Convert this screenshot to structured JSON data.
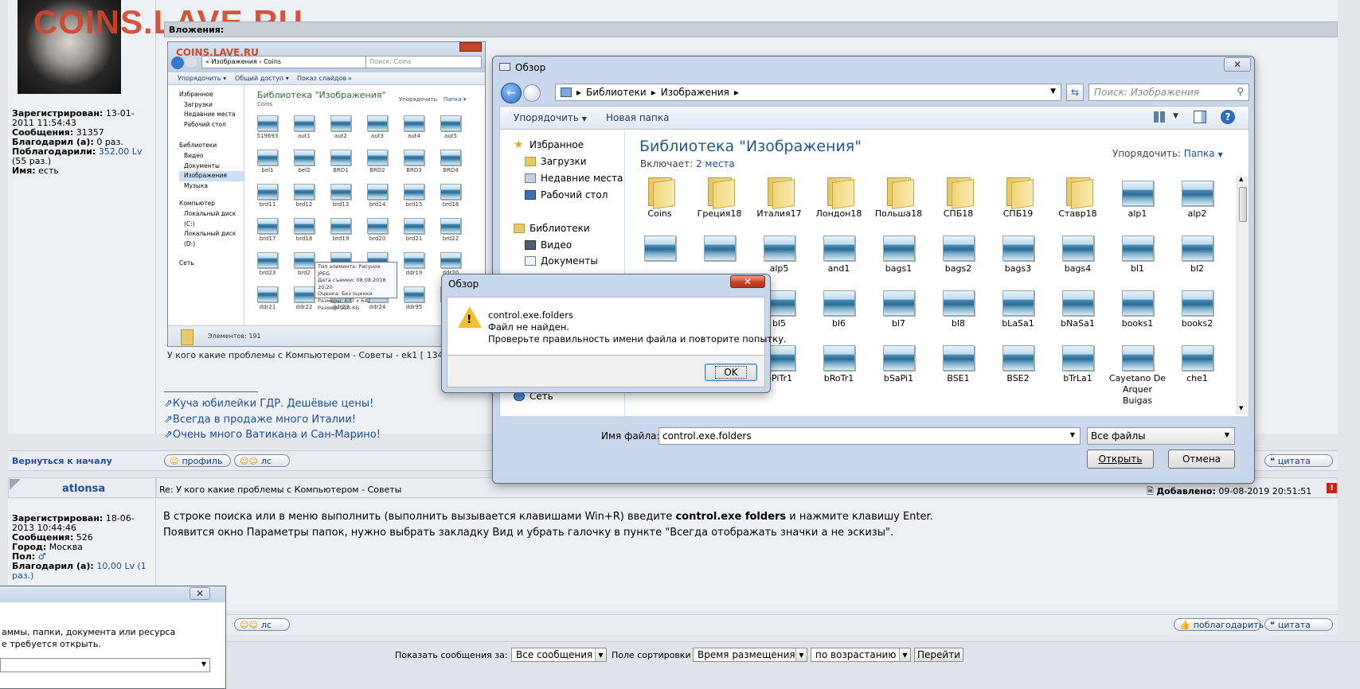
{
  "watermark": {
    "main": "COINS.LAVE.RU",
    "small": "COINS.LAVE.RU"
  },
  "post1": {
    "attachments_label": "Вложения:",
    "user_info": [
      {
        "k": "Зарегистрирован:",
        "v": "13-01-2011 11:54:43"
      },
      {
        "k": "Сообщения:",
        "v": "31357"
      },
      {
        "k": "Благодарил (а):",
        "v": "0 раз."
      },
      {
        "k": "Поблагодарили:",
        "v": "352,00 Lv"
      },
      {
        "k": "",
        "v": "(55 раз.)"
      },
      {
        "k": "Имя:",
        "v": "есть"
      }
    ],
    "caption": "У кого какие проблемы с Компьютером - Советы - ek1 [ 134",
    "signature_links": [
      "Куча юбилейки ГДР. Дешёвые цены!",
      "Всегда в продаже много Италии!",
      "Очень много Ватикана и Сан-Марино!"
    ],
    "back_to_top": "Вернуться к началу",
    "btn_profile": "профиль",
    "btn_pm": "лс",
    "btn_quote": "цитата"
  },
  "attachment_screenshot": {
    "breadcrumb": "« Изображения › Coins",
    "search_placeholder": "Поиск: Coins",
    "toolbar": [
      "Упорядочить ▾",
      "Общий доступ ▾",
      "Показ слайдов",
      "»"
    ],
    "library_title": "Библиотека \"Изображения\"",
    "library_sub": "Coins",
    "arrange_label": "Упорядочить:",
    "arrange_value": "Папка ▾",
    "nav": [
      "Избранное",
      "Загрузки",
      "Недавние места",
      "Рабочий стол",
      "Библиотеки",
      "Видео",
      "Документы",
      "Изображения",
      "Музыка",
      "Компьютер",
      "Локальный диск (C:)",
      "Локальный диск (D:)",
      "Сеть"
    ],
    "rows": [
      [
        "519693",
        "aut1",
        "aut2",
        "aut3",
        "aut4",
        "aut5"
      ],
      [
        "bel1",
        "bel2",
        "BRD1",
        "BRD2",
        "BRD3",
        "BRD4"
      ],
      [
        "brd11",
        "brd12",
        "brd13",
        "brd14",
        "brd15",
        "brd16"
      ],
      [
        "brd17",
        "brd18",
        "brd19",
        "brd20",
        "brd21",
        "brd22"
      ],
      [
        "brd23",
        "brd2",
        "",
        "",
        "ddr19",
        "ddr20"
      ],
      [
        "ddr21",
        "ddr22",
        "ddr23",
        "ddr24",
        "ddr95",
        ""
      ]
    ],
    "tooltip": [
      "Тип элемента: Рисунок JPEG",
      "Дата съемки: 08.08.2018 20:20",
      "Оценка: Без оценки",
      "Размеры: 637 x 642",
      "Размер: 210 КБ"
    ],
    "status": "Элементов: 191"
  },
  "post2": {
    "author": "atlonsa",
    "title": "Re: У кого какие проблемы с Компьютером - Советы",
    "added_label": "Добавлено:",
    "added_value": "09-08-2019 20:51:51",
    "user_info": [
      {
        "k": "Зарегистрирован:",
        "v": "18-06-2013 10:44:46"
      },
      {
        "k": "Сообщения:",
        "v": "526"
      },
      {
        "k": "Город:",
        "v": "Москва"
      },
      {
        "k": "Пол:",
        "v": "♂"
      },
      {
        "k": "Благодарил (а):",
        "v": "10,00 Lv (1 раз.)"
      }
    ],
    "body_pre": "В строке поиска или в меню выполнить (выполнить вызывается клавишами Win+R) введите ",
    "body_bold": "control.exe folders",
    "body_post": " и нажмите клавишу Enter.",
    "body_line2": "Появится окно Параметры папок, нужно выбрать закладку Вид и убрать галочку в пункте \"Всегда отображать значки а не эскизы\".",
    "btn_pm": "лс",
    "btn_thank": "поблагодарить",
    "btn_quote": "цитата"
  },
  "run_fragment": {
    "line1": "аммы, папки, документа или ресурса",
    "line2": "е требуется открыть."
  },
  "footer": {
    "show_label": "Показать сообщения за:",
    "show_value": "Все сообщения",
    "sort_label": "Поле сортировки",
    "sort_value": "Время размещения",
    "order_value": "по возрастанию",
    "go": "Перейти"
  },
  "browse": {
    "title": "Обзор",
    "crumbs": [
      "Библиотеки",
      "Изображения"
    ],
    "search_placeholder": "Поиск: Изображения",
    "cmd_organize": "Упорядочить",
    "cmd_newfolder": "Новая папка",
    "nav": {
      "favorites": "Избранное",
      "downloads": "Загрузки",
      "recent": "Недавние места",
      "desktop": "Рабочий стол",
      "libraries": "Библиотеки",
      "videos": "Видео",
      "documents": "Документы",
      "network": "Сеть"
    },
    "library_title": "Библиотека \"Изображения\"",
    "includes_label": "Включает:",
    "includes_value": "2 места",
    "arrange_label": "Упорядочить:",
    "arrange_value": "Папка",
    "row1": [
      "Coins",
      "Греция18",
      "Италия17",
      "Лондон18",
      "Польша18",
      "СПБ18",
      "СПБ19",
      "Ставр18",
      "alp1",
      "alp2"
    ],
    "row2": [
      "",
      "",
      "alp5",
      "and1",
      "bags1",
      "bags2",
      "bags3",
      "bags4",
      "bl1",
      "bl2"
    ],
    "row3": [
      "",
      "",
      "bl5",
      "bl6",
      "bl7",
      "bl8",
      "bLaSa1",
      "bNaSa1",
      "books1",
      "books2"
    ],
    "row4": [
      "",
      "",
      "bPiTr1",
      "bRoTr1",
      "bSaPi1",
      "BSE1",
      "BSE2",
      "bTrLa1",
      "Cayetano De Arquer Buigas",
      "che1"
    ],
    "filename_label": "Имя файла:",
    "filename_value": "control.exe.folders",
    "filter_value": "Все файлы",
    "open": "Открыть",
    "cancel": "Отмена"
  },
  "error": {
    "title": "Обзор",
    "line1": "control.exe.folders",
    "line2": "Файл не найден.",
    "line3": "Проверьте правильность имени файла и повторите попытку.",
    "ok": "OK"
  }
}
